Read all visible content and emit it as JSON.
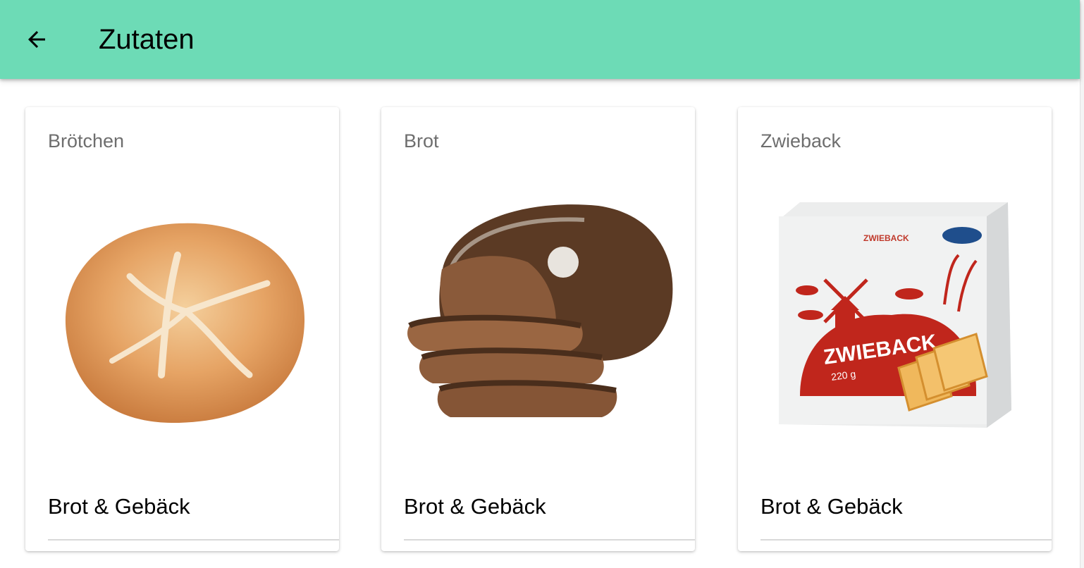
{
  "appbar": {
    "title": "Zutaten",
    "back_icon": "arrow-left-icon",
    "color": "#6ddbb6"
  },
  "cards": [
    {
      "name": "Brötchen",
      "category": "Brot & Gebäck",
      "image": "bread-roll-image"
    },
    {
      "name": "Brot",
      "category": "Brot & Gebäck",
      "image": "bread-loaf-image"
    },
    {
      "name": "Zwieback",
      "category": "Brot & Gebäck",
      "image": "zwieback-package-image",
      "package_text": {
        "brand": "ZWIEBACK",
        "weight": "220 g"
      }
    }
  ]
}
